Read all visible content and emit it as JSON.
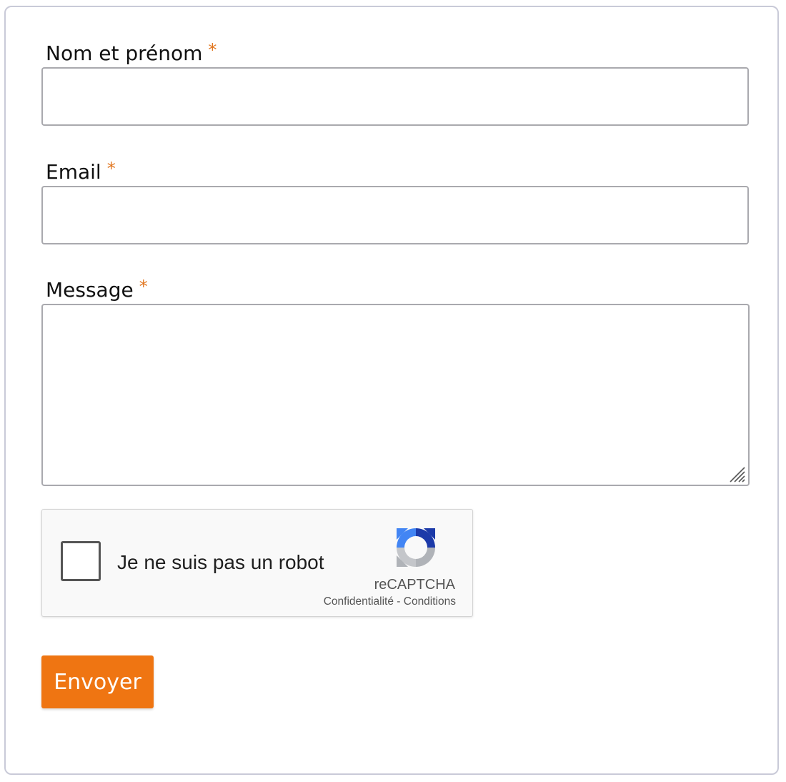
{
  "form": {
    "name": {
      "label": "Nom et prénom",
      "required_marker": "*",
      "value": "",
      "placeholder": ""
    },
    "email": {
      "label": "Email",
      "required_marker": "*",
      "value": "",
      "placeholder": ""
    },
    "message": {
      "label": "Message",
      "required_marker": "*",
      "value": "",
      "placeholder": ""
    },
    "submit_label": "Envoyer"
  },
  "recaptcha": {
    "checkbox_label": "Je ne suis pas un robot",
    "checked": false,
    "brand": "reCAPTCHA",
    "privacy_link": "Confidentialité",
    "separator": "-",
    "terms_link": "Conditions",
    "logo_icon": "recaptcha-logo-icon"
  },
  "colors": {
    "required_marker": "#e1761f",
    "submit_background": "#ef7512",
    "field_border": "#a9a9ae",
    "frame_border": "#c9cad8"
  }
}
